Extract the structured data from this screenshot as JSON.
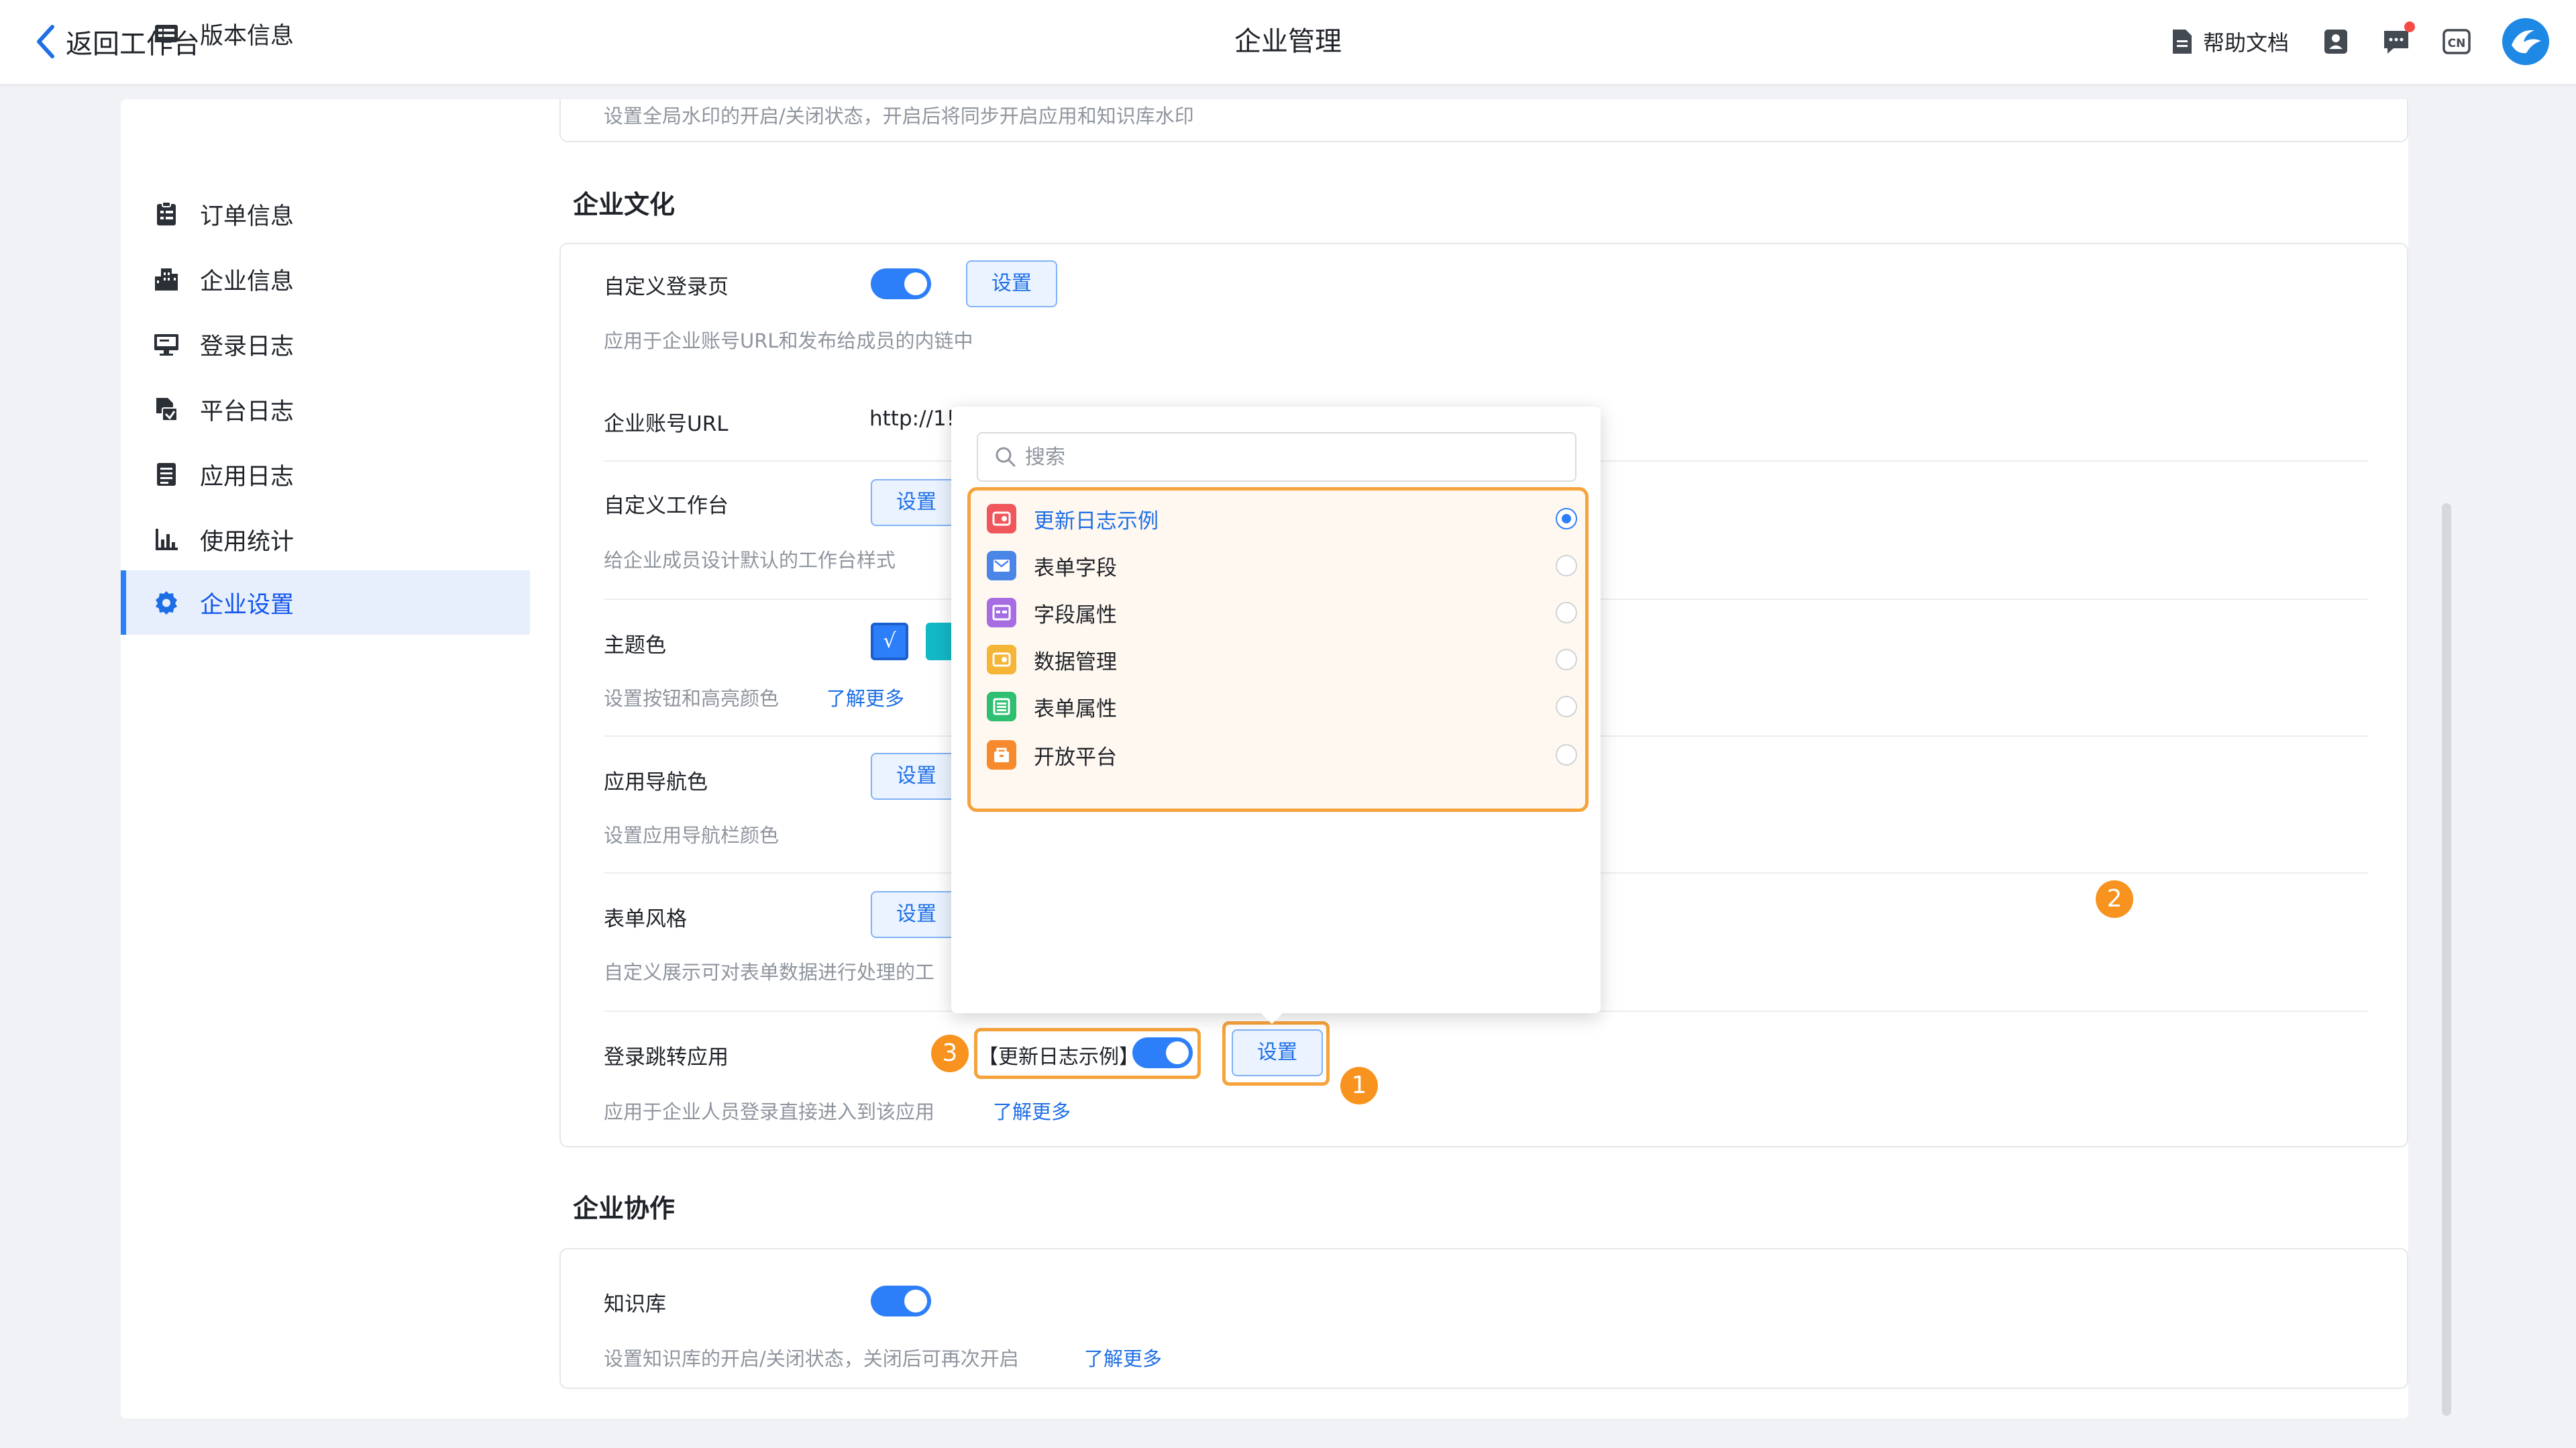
{
  "topbar": {
    "back_label": "返回工作台",
    "title": "企业管理",
    "help_label": "帮助文档",
    "lang_label": "CN",
    "icons": [
      "contacts-icon",
      "message-icon",
      "language-icon"
    ]
  },
  "sidebar": {
    "items": [
      {
        "label": "版本信息",
        "icon": "version-icon"
      },
      {
        "label": "订单信息",
        "icon": "order-icon"
      },
      {
        "label": "企业信息",
        "icon": "building-icon"
      },
      {
        "label": "登录日志",
        "icon": "monitor-icon"
      },
      {
        "label": "平台日志",
        "icon": "platform-log-icon"
      },
      {
        "label": "应用日志",
        "icon": "app-log-icon"
      },
      {
        "label": "使用统计",
        "icon": "bar-chart-icon"
      },
      {
        "label": "企业设置",
        "icon": "gear-icon",
        "active": true
      }
    ]
  },
  "top_card": {
    "desc": "设置全局水印的开启/关闭状态，开启后将同步开启应用和知识库水印"
  },
  "culture": {
    "title": "企业文化",
    "custom_login": {
      "label": "自定义登录页",
      "button": "设置",
      "desc": "应用于企业账号URL和发布给成员的内链中"
    },
    "account_url": {
      "label": "企业账号URL",
      "value": "http://1!"
    },
    "custom_workbench": {
      "label": "自定义工作台",
      "button": "设置",
      "desc": "给企业成员设计默认的工作台样式"
    },
    "theme": {
      "label": "主题色",
      "desc": "设置按钮和高亮颜色",
      "link": "了解更多",
      "check": "√",
      "colors": [
        "#2d7ff9",
        "#13b8c6"
      ]
    },
    "app_nav": {
      "label": "应用导航色",
      "button": "设置",
      "desc": "设置应用导航栏颜色"
    },
    "form_style": {
      "label": "表单风格",
      "button": "设置",
      "desc": "自定义展示可对表单数据进行处理的工"
    },
    "login_redirect": {
      "label": "登录跳转应用",
      "app_tag": "【更新日志示例】",
      "button": "设置",
      "desc": "应用于企业人员登录直接进入到该应用",
      "link": "了解更多"
    }
  },
  "collab": {
    "title": "企业协作",
    "kb": {
      "label": "知识库",
      "desc": "设置知识库的开启/关闭状态，关闭后可再次开启",
      "link": "了解更多"
    }
  },
  "dropdown": {
    "search_placeholder": "搜索",
    "apps": [
      {
        "label": "更新日志示例",
        "color": "#f0575c",
        "selected": true
      },
      {
        "label": "表单字段",
        "color": "#4a86e8",
        "selected": false
      },
      {
        "label": "字段属性",
        "color": "#a66de3",
        "selected": false
      },
      {
        "label": "数据管理",
        "color": "#f5b638",
        "selected": false
      },
      {
        "label": "表单属性",
        "color": "#2fbf71",
        "selected": false
      },
      {
        "label": "开放平台",
        "color": "#f78a2d",
        "selected": false
      }
    ]
  },
  "badges": {
    "one": "1",
    "two": "2",
    "three": "3"
  },
  "colors": {
    "accent": "#2d7ff9",
    "highlight": "#f5a33a",
    "badge": "#f7931e"
  }
}
